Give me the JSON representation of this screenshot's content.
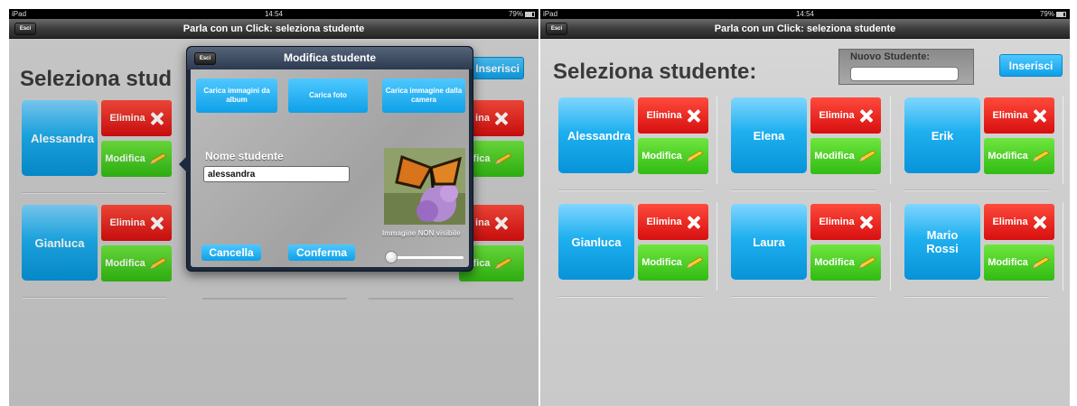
{
  "status_bar": {
    "carrier": "iPad",
    "time": "14:54",
    "battery": "79%"
  },
  "nav": {
    "title": "Parla con un Click: seleziona studente",
    "esc_label": "Esci"
  },
  "left_screen": {
    "heading": "Seleziona stud",
    "insert_label": "Inserisci",
    "cards": [
      {
        "name": "Alessandra",
        "delete_label": "Elimina",
        "edit_label": "Modifica"
      },
      {
        "name": "Gianluca",
        "delete_label": "Elimina",
        "edit_label": "Modifica"
      }
    ],
    "right_partial": [
      {
        "delete_label": "ina",
        "edit_label": "ifica"
      },
      {
        "delete_label": "ina",
        "edit_label": "ifica"
      }
    ]
  },
  "popover": {
    "title": "Modifica studente",
    "esc_label": "Esci",
    "btn_album": "Carica immagini da album",
    "btn_photo": "Carica foto",
    "btn_camera": "Carica immagine dalla camera",
    "name_label": "Nome studente",
    "name_value": "alessandra",
    "visibility_label": "Immagine NON visibile",
    "visibility_value": 0,
    "cancel_label": "Cancella",
    "confirm_label": "Conferma"
  },
  "right_screen": {
    "heading": "Seleziona studente:",
    "new_student_label": "Nuovo Studente:",
    "new_student_value": "",
    "insert_label": "Inserisci",
    "cards": [
      {
        "name": "Alessandra",
        "delete_label": "Elimina",
        "edit_label": "Modifica"
      },
      {
        "name": "Elena",
        "delete_label": "Elimina",
        "edit_label": "Modifica"
      },
      {
        "name": "Erik",
        "delete_label": "Elimina",
        "edit_label": "Modifica"
      },
      {
        "name": "Gianluca",
        "delete_label": "Elimina",
        "edit_label": "Modifica"
      },
      {
        "name": "Laura",
        "delete_label": "Elimina",
        "edit_label": "Modifica"
      },
      {
        "name": "Mario Rossi",
        "delete_label": "Elimina",
        "edit_label": "Modifica"
      }
    ]
  },
  "colors": {
    "student_blue": "#1fb0ef",
    "delete_red": "#e01a14",
    "edit_green": "#3fc81c",
    "nav_dark": "#2e2e2e"
  }
}
